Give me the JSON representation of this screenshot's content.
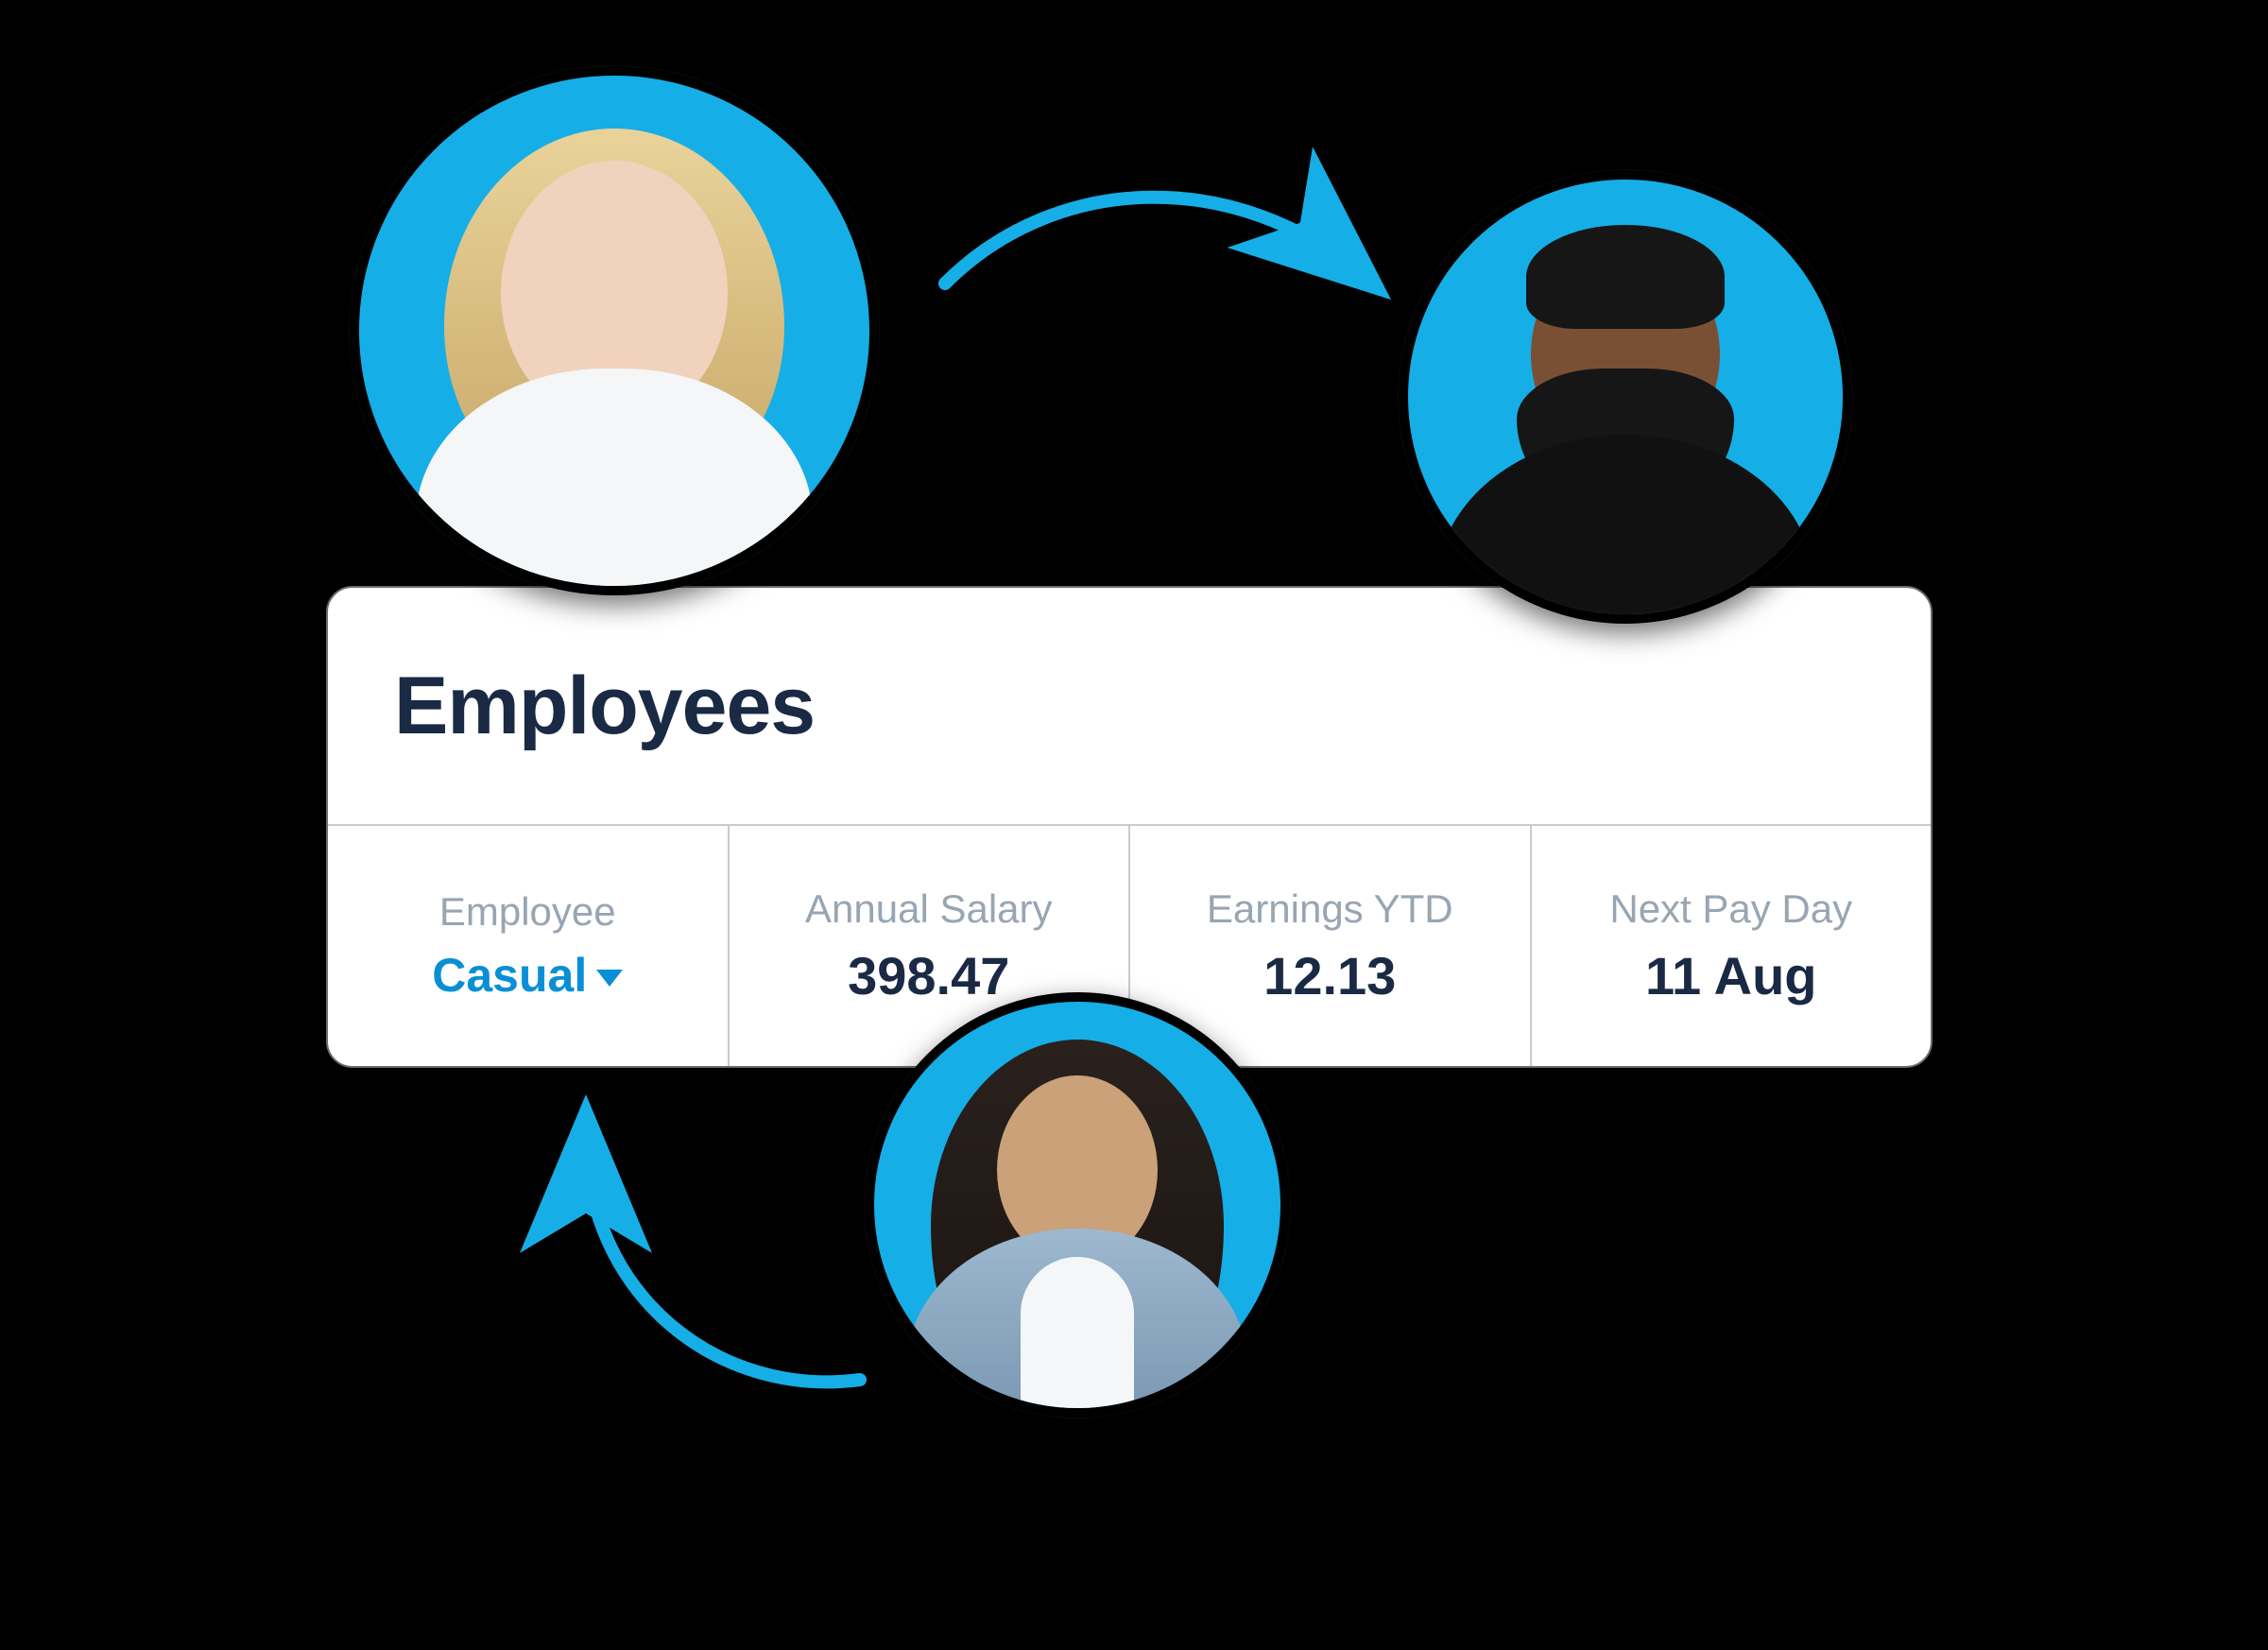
{
  "card": {
    "title": "Employees",
    "columns": [
      {
        "label": "Employee"
      },
      {
        "label": "Annual Salary",
        "value": "398.47"
      },
      {
        "label": "Earnings YTD",
        "value": "12.13"
      },
      {
        "label": "Next Pay Day",
        "value": "11 Aug"
      }
    ],
    "employee_select": {
      "value": "Casual"
    }
  },
  "avatars": [
    {
      "name": "employee-avatar-1"
    },
    {
      "name": "employee-avatar-2"
    },
    {
      "name": "employee-avatar-3"
    }
  ],
  "colors": {
    "accent": "#16aee6",
    "text_dark": "#1a2a44",
    "text_muted": "#98a5b3",
    "link": "#0a8fd6"
  }
}
